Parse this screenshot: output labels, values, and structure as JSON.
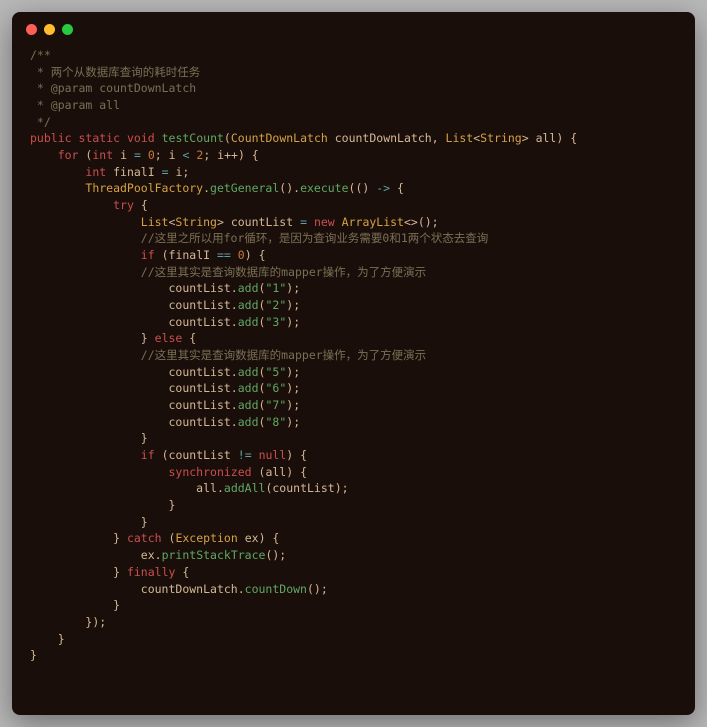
{
  "traffic_lights": [
    "red",
    "yellow",
    "green"
  ],
  "code": {
    "comment_block": [
      "/**",
      " * 两个从数据库查询的耗时任务",
      " * @param countDownLatch",
      " * @param all",
      " */"
    ],
    "method_sig": {
      "kw_public": "public",
      "kw_static": "static",
      "kw_void": "void",
      "name": "testCount",
      "p1_type": "CountDownLatch",
      "p1_name": "countDownLatch",
      "p2_type_outer": "List",
      "p2_type_inner": "String",
      "p2_name": "all"
    },
    "for_loop": {
      "kw_for": "for",
      "kw_int": "int",
      "var": "i",
      "init": "0",
      "cond_val": "2",
      "inc": "i++"
    },
    "finalI": {
      "kw_int": "int",
      "name": "finalI",
      "val": "i"
    },
    "pool": {
      "factory": "ThreadPoolFactory",
      "getGeneral": "getGeneral",
      "execute": "execute"
    },
    "try_kw": "try",
    "countList_decl": {
      "type_outer": "List",
      "type_inner": "String",
      "name": "countList",
      "kw_new": "new",
      "ctor": "ArrayList"
    },
    "cmt_for_reason": "//这里之所以用for循环，是因为查询业务需要0和1两个状态去查询",
    "if1": {
      "kw_if": "if",
      "var": "finalI",
      "val": "0"
    },
    "cmt_mapper": "//这里其实是查询数据库的mapper操作，为了方便演示",
    "add_calls_a": [
      "1",
      "2",
      "3"
    ],
    "kw_else": "else",
    "add_calls_b": [
      "5",
      "6",
      "7",
      "8"
    ],
    "add_target": "countList",
    "add_meth": "add",
    "if2": {
      "kw_if": "if",
      "var": "countList",
      "kw_null": "null"
    },
    "sync": {
      "kw": "synchronized",
      "arg": "all",
      "target": "all",
      "meth": "addAll",
      "param": "countList"
    },
    "catch": {
      "kw": "catch",
      "type": "Exception",
      "name": "ex",
      "call_target": "ex",
      "call_meth": "printStackTrace"
    },
    "finally": {
      "kw": "finally",
      "target": "countDownLatch",
      "meth": "countDown"
    }
  }
}
